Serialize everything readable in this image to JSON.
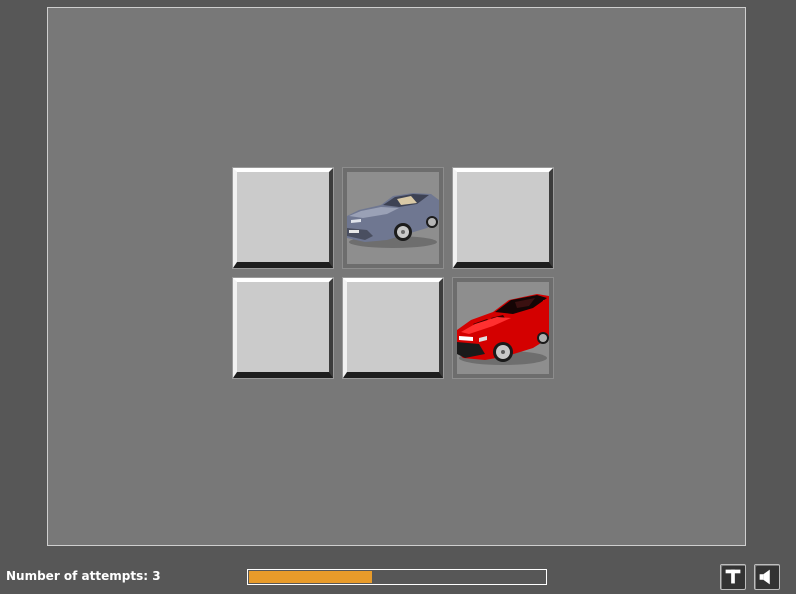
{
  "game": {
    "cards": [
      {
        "state": "face-down",
        "image": ""
      },
      {
        "state": "face-up",
        "image": "silver-sports-car"
      },
      {
        "state": "face-down",
        "image": ""
      },
      {
        "state": "face-down",
        "image": ""
      },
      {
        "state": "face-down",
        "image": ""
      },
      {
        "state": "face-up",
        "image": "red-sports-car"
      }
    ]
  },
  "status": {
    "attempts_text": "Number of attempts: 3",
    "progress_fraction": 0.42
  },
  "toolbar": {
    "text_button_icon": "text-t-icon",
    "sound_button_icon": "speaker-icon"
  },
  "colors": {
    "background": "#575757",
    "board": "#787878",
    "card_back": "#cbcbcb",
    "progress_fill": "#e89b2a",
    "silver_car": "#6f7791",
    "red_car": "#d40000"
  }
}
